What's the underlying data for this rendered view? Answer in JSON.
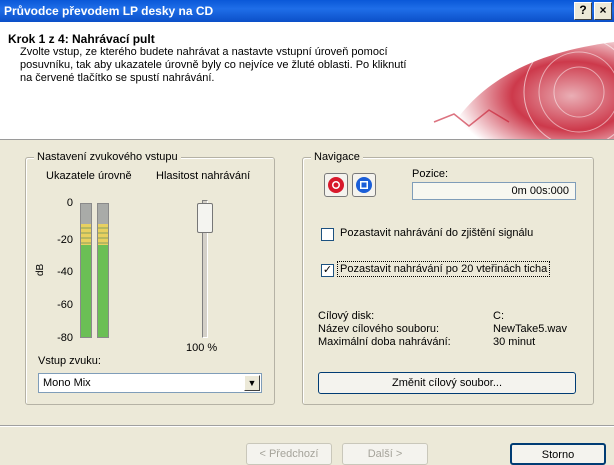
{
  "window": {
    "title": "Průvodce převodem LP desky na CD",
    "help_label": "?",
    "close_label": "×"
  },
  "header": {
    "step_title": "Krok 1 z 4: Nahrávací pult",
    "description": "Zvolte vstup, ze kterého budete nahrávat a nastavte vstupní úroveň pomocí posuvníku, tak aby ukazatele úrovně byly co nejvíce ve žluté oblasti. Po kliknutí na červené tlačítko se spustí nahrávání."
  },
  "input_group": {
    "label": "Nastavení zvukového vstupu",
    "meters_label": "Ukazatele úrovně",
    "volume_label": "Hlasitost nahrávání",
    "db_unit": "dB",
    "scale": [
      "0",
      "-20",
      "-40",
      "-60",
      "-80"
    ],
    "volume_value": "100 %",
    "volume_level": 1.0,
    "input_label": "Vstup zvuku:",
    "input_value": "Mono Mix"
  },
  "nav_group": {
    "label": "Navigace",
    "position_label": "Pozice:",
    "position_value": "0m 00s:000",
    "pause_until_signal": "Pozastavit nahrávání do zjištění signálu",
    "pause_until_signal_checked": false,
    "pause_after_silence": "Pozastavit nahrávání po 20 vteřinách ticha",
    "pause_after_silence_checked": true,
    "target_disk_label": "Cílový disk:",
    "target_disk_value": "C:",
    "target_file_label": "Název cílového souboru:",
    "target_file_value": "NewTake5.wav",
    "max_time_label": "Maximální doba nahrávání:",
    "max_time_value": "30 minut",
    "change_file_button": "Změnit cílový soubor..."
  },
  "footer": {
    "back": "< Předchozí",
    "next": "Další >",
    "cancel": "Storno"
  },
  "colors": {
    "record": "#d8192b",
    "stop": "#1a5ed8",
    "accent": "#c4162b"
  }
}
